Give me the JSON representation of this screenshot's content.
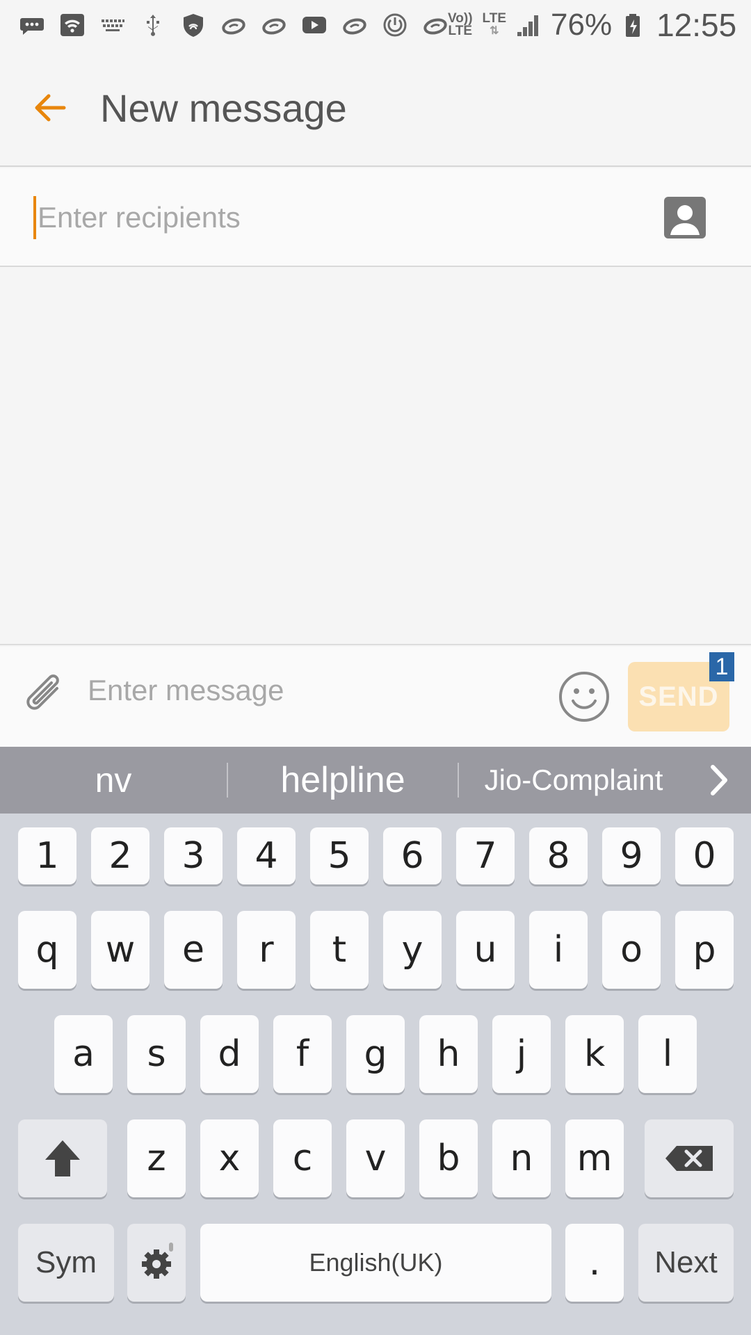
{
  "status_bar": {
    "volte_label_1": "Vo))",
    "volte_label_2": "LTE",
    "lte_label": "LTE",
    "battery_pct": "76%",
    "time": "12:55",
    "icons": [
      "messages-icon",
      "wifi-box-icon",
      "keyboard-icon",
      "usb-icon",
      "shield-icon",
      "swirl-icon",
      "swirl-icon",
      "youtube-icon",
      "swirl-icon",
      "power-cycle-icon",
      "swirl-icon",
      "signal-icon",
      "battery-charging-icon"
    ]
  },
  "app_bar": {
    "title": "New message",
    "back_icon": "back-arrow-icon",
    "accent_color": "#e8860c"
  },
  "recipients": {
    "placeholder": "Enter recipients",
    "value": "",
    "contact_icon": "contact-icon"
  },
  "compose": {
    "placeholder": "Enter message",
    "value": "",
    "send_label": "SEND",
    "badge": "1",
    "badge_color": "#2a67a8",
    "send_color": "#fbe0b2"
  },
  "keyboard": {
    "suggestions": [
      "nv",
      "helpline",
      "Jio-Complaint"
    ],
    "row_numbers": [
      "1",
      "2",
      "3",
      "4",
      "5",
      "6",
      "7",
      "8",
      "9",
      "0"
    ],
    "row_1": [
      "q",
      "w",
      "e",
      "r",
      "t",
      "y",
      "u",
      "i",
      "o",
      "p"
    ],
    "row_2": [
      "a",
      "s",
      "d",
      "f",
      "g",
      "h",
      "j",
      "k",
      "l"
    ],
    "row_3": [
      "z",
      "x",
      "c",
      "v",
      "b",
      "n",
      "m"
    ],
    "sym_label": "Sym",
    "space_label": "English(UK)",
    "period_label": ".",
    "next_label": "Next"
  }
}
